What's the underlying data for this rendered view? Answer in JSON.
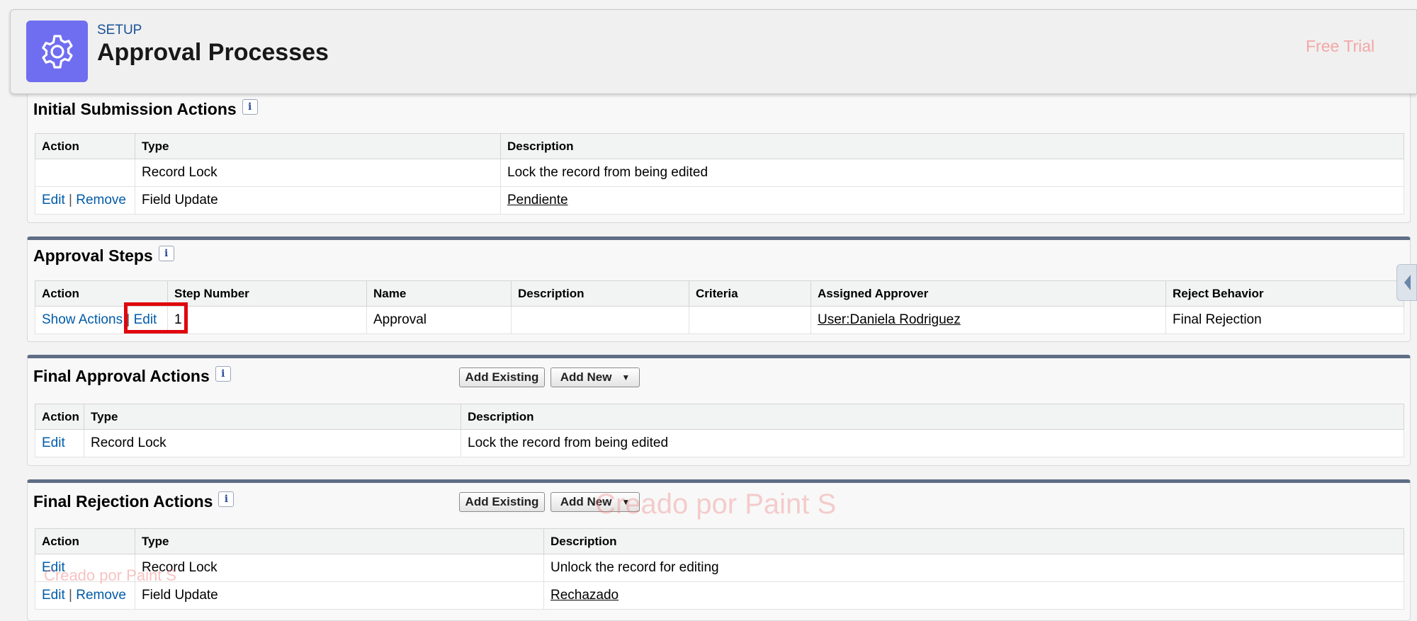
{
  "header": {
    "setup_label": "SETUP",
    "title": "Approval Processes",
    "free_trial": "Free Trial"
  },
  "initial_submission": {
    "title": "Initial Submission Actions",
    "columns": [
      "Action",
      "Type",
      "Description"
    ],
    "rows": [
      {
        "type": "Record Lock",
        "description": "Lock the record from being edited"
      },
      {
        "edit": "Edit",
        "remove": "Remove",
        "type": "Field Update",
        "description": "Pendiente"
      }
    ]
  },
  "approval_steps": {
    "title": "Approval Steps",
    "columns": [
      "Action",
      "Step Number",
      "Name",
      "Description",
      "Criteria",
      "Assigned Approver",
      "Reject Behavior"
    ],
    "row": {
      "show_actions": "Show Actions",
      "edit": "Edit",
      "step_number": "1",
      "name": "Approval",
      "description": "",
      "criteria": "",
      "assigned_approver": "User:Daniela Rodriguez",
      "reject_behavior": "Final Rejection"
    }
  },
  "final_approval": {
    "title": "Final Approval Actions",
    "add_existing": "Add Existing",
    "add_new": "Add New",
    "columns": [
      "Action",
      "Type",
      "Description"
    ],
    "rows": [
      {
        "edit": "Edit",
        "type": "Record Lock",
        "description": "Lock the record from being edited"
      }
    ]
  },
  "final_rejection": {
    "title": "Final Rejection Actions",
    "add_existing": "Add Existing",
    "add_new": "Add New",
    "columns": [
      "Action",
      "Type",
      "Description"
    ],
    "rows": [
      {
        "edit": "Edit",
        "type": "Record Lock",
        "description": "Unlock the record for editing"
      },
      {
        "edit": "Edit",
        "remove": "Remove",
        "type": "Field Update",
        "description": "Rechazado"
      }
    ]
  },
  "watermark": {
    "text": "Creado por Paint S"
  },
  "colors": {
    "header_icon": "#6f6ef0",
    "link": "#015ba7",
    "section_border": "#5f6d85",
    "highlight": "#e0060d"
  },
  "icons": {
    "header": "gear-icon",
    "info": "info-icon",
    "dropdown": "caret-down-icon",
    "side_tab": "chevron-left-icon"
  }
}
